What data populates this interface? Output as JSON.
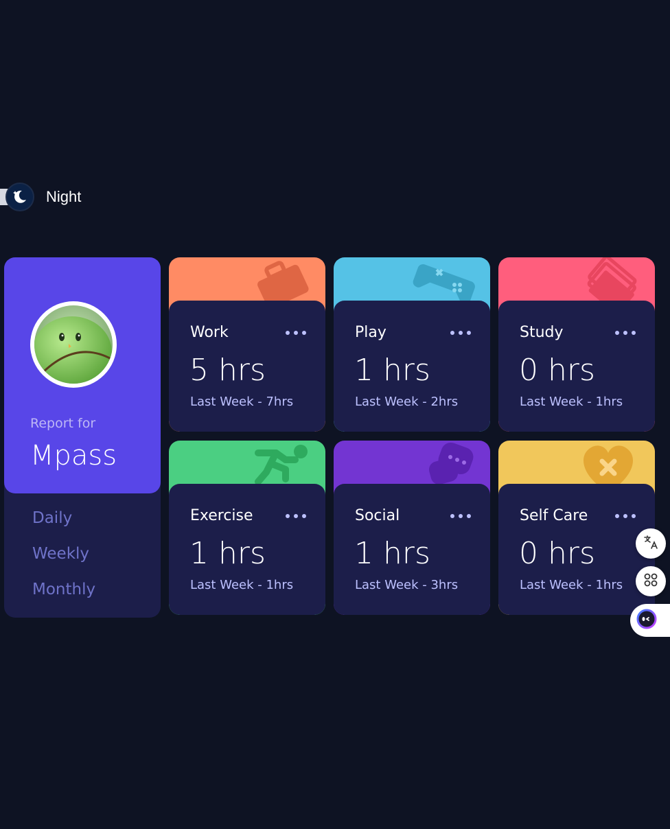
{
  "theme_toggle": {
    "label": "Night"
  },
  "profile": {
    "report_for": "Report for",
    "name": "Mpass",
    "periods": [
      "Daily",
      "Weekly",
      "Monthly"
    ]
  },
  "cards": [
    {
      "title": "Work",
      "hours": "5 hrs",
      "last_week": "Last Week - 7hrs",
      "color": "#ff8b64",
      "icon": "briefcase-icon"
    },
    {
      "title": "Play",
      "hours": "1 hrs",
      "last_week": "Last Week - 2hrs",
      "color": "#55c2e6",
      "icon": "gamepad-icon"
    },
    {
      "title": "Study",
      "hours": "0 hrs",
      "last_week": "Last Week - 1hrs",
      "color": "#ff5e7d",
      "icon": "books-icon"
    },
    {
      "title": "Exercise",
      "hours": "1 hrs",
      "last_week": "Last Week - 1hrs",
      "color": "#4bcf82",
      "icon": "runner-icon"
    },
    {
      "title": "Social",
      "hours": "1 hrs",
      "last_week": "Last Week - 3hrs",
      "color": "#7335d2",
      "icon": "chat-icon"
    },
    {
      "title": "Self Care",
      "hours": "0 hrs",
      "last_week": "Last Week - 1hrs",
      "color": "#f1c75b",
      "icon": "heart-icon"
    }
  ]
}
